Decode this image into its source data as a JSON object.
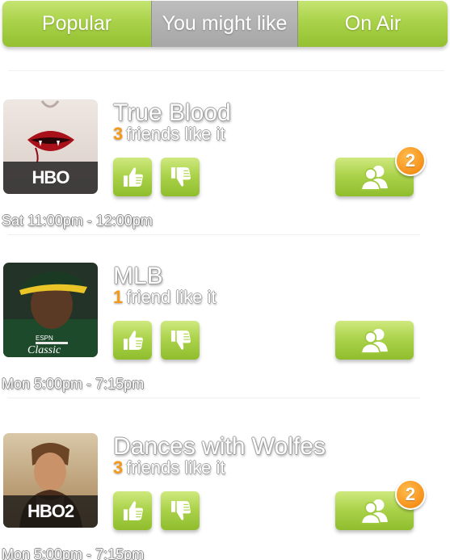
{
  "tabs": [
    {
      "label": "Popular",
      "selected": false
    },
    {
      "label": "You might like",
      "selected": true
    },
    {
      "label": "On Air",
      "selected": false
    }
  ],
  "colors": {
    "accent_green": "#a9d249",
    "tab_selected_gray": "#b3b3b3",
    "count_orange": "#f39a1a",
    "badge_orange": "#f7941d"
  },
  "shows": [
    {
      "title": "True Blood",
      "friend_count": "3",
      "friend_text": "friends like it",
      "network": "HBO",
      "time": "Sat 11:00pm - 12:00pm",
      "notification_count": "2",
      "icons": {
        "like": "thumbs-up-icon",
        "dislike": "thumbs-down-icon",
        "friends": "people-icon"
      }
    },
    {
      "title": "MLB",
      "friend_count": "1",
      "friend_text": "friend like it",
      "network": "ESPN Classic",
      "time": "Mon 5:00pm - 7:15pm",
      "notification_count": "",
      "icons": {
        "like": "thumbs-up-icon",
        "dislike": "thumbs-down-icon",
        "friends": "people-icon"
      }
    },
    {
      "title": "Dances with Wolfes",
      "friend_count": "3",
      "friend_text": "friends like it",
      "network": "HBO2",
      "time": "Mon 5:00pm - 7:15pm",
      "notification_count": "2",
      "icons": {
        "like": "thumbs-up-icon",
        "dislike": "thumbs-down-icon",
        "friends": "people-icon"
      }
    }
  ]
}
